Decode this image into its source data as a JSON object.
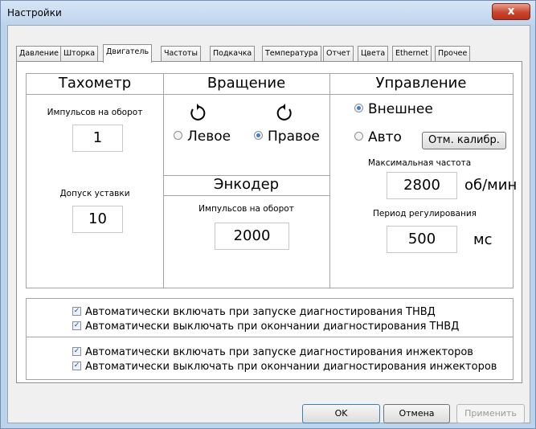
{
  "window": {
    "title": "Настройки",
    "close_label": "x"
  },
  "tabs": [
    {
      "label": "Давление"
    },
    {
      "label": "Шторка"
    },
    {
      "label": "Двигатель"
    },
    {
      "label": "Частоты"
    },
    {
      "label": "Подкачка"
    },
    {
      "label": "Температура"
    },
    {
      "label": "Отчет"
    },
    {
      "label": "Цвета"
    },
    {
      "label": "Ethernet"
    },
    {
      "label": "Прочее"
    }
  ],
  "active_tab": "Двигатель",
  "tachometer": {
    "title": "Тахометр",
    "pulses_label": "Импульсов на оборот",
    "pulses_value": "1",
    "tolerance_label": "Допуск уставки",
    "tolerance_value": "10"
  },
  "rotation": {
    "title": "Вращение",
    "left_icon": "rotate-ccw-icon",
    "right_icon": "rotate-cw-icon",
    "left_label": "Левое",
    "right_label": "Правое",
    "selected": "Правое"
  },
  "encoder": {
    "title": "Энкодер",
    "pulses_label": "Импульсов на оборот",
    "pulses_value": "2000"
  },
  "control": {
    "title": "Управление",
    "external_label": "Внешнее",
    "auto_label": "Авто",
    "selected": "Внешнее",
    "cancel_calib_label": "Отм. калибр.",
    "max_freq_label": "Максимальная частота",
    "max_freq_value": "2800",
    "max_freq_unit": "об/мин",
    "period_label": "Период регулирования",
    "period_value": "500",
    "period_unit": "мс"
  },
  "options": {
    "group1": [
      {
        "label": "Автоматически включать при запуске диагностирования ТНВД",
        "checked": true
      },
      {
        "label": "Автоматически выключать при окончании диагностирования ТНВД",
        "checked": true
      }
    ],
    "group2": [
      {
        "label": "Автоматически включать при запуске диагностирования инжекторов",
        "checked": true
      },
      {
        "label": "Автоматически выключать при окончании диагностирования инжекторов",
        "checked": true
      }
    ]
  },
  "buttons": {
    "ok": "OK",
    "cancel": "Отмена",
    "apply": "Применить"
  },
  "colors": {
    "accent": "#3e7fd0",
    "close_red": "#c9452d",
    "border": "#a4a4a4"
  }
}
